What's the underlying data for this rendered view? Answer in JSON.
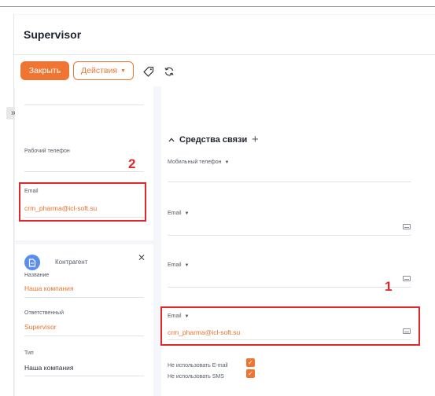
{
  "header": {
    "title": "Supervisor"
  },
  "toolbar": {
    "close_label": "Закрыть",
    "actions_label": "Действия",
    "caret": "▼"
  },
  "left": {
    "work_phone_label": "Рабочий телефон",
    "email_label": "Email",
    "email_value": "crm_pharma@icl-soft.su",
    "counterparty_title": "Контрагент",
    "name_label": "Название",
    "name_value": "Наша компания",
    "responsible_label": "Ответственный",
    "responsible_value": "Supervisor",
    "type_label": "Тип",
    "type_value": "Наша компания"
  },
  "right": {
    "section_title": "Средства связи",
    "mobile_label": "Мобильный телефон",
    "email1_label": "Email",
    "email2_label": "Email",
    "email3_label": "Email",
    "email3_value": "crm_pharma@icl-soft.su",
    "no_email_label": "Не использовать E-mail",
    "no_sms_label": "Не использовать SMS",
    "no_email_checked": true,
    "no_sms_checked": true
  },
  "annotations": {
    "marker_1": "1",
    "marker_2": "2"
  },
  "colors": {
    "accent": "#ee7632",
    "marker": "#e3262a",
    "avatar": "#5b8def"
  },
  "icons": [
    "tag-icon",
    "refresh-icon",
    "expand-sidebar-icon",
    "mail-icon",
    "document-icon",
    "close-icon",
    "plus-icon",
    "chevron-up-icon"
  ]
}
